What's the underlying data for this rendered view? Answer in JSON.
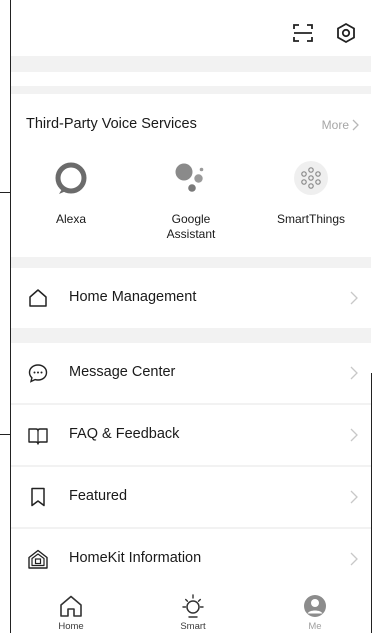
{
  "voice_services": {
    "title": "Third-Party Voice Services",
    "more_label": "More",
    "items": [
      {
        "name": "Alexa",
        "icon": "alexa-ring-icon"
      },
      {
        "name": "Google\nAssistant",
        "icon": "google-assistant-dots-icon"
      },
      {
        "name": "SmartThings",
        "icon": "smartthings-icon"
      }
    ]
  },
  "menu": [
    {
      "label": "Home Management",
      "icon": "house-outline-icon"
    },
    {
      "label": "Message Center",
      "icon": "chat-bubble-icon"
    },
    {
      "label": "FAQ & Feedback",
      "icon": "open-book-icon"
    },
    {
      "label": "Featured",
      "icon": "bookmark-icon"
    },
    {
      "label": "HomeKit Information",
      "icon": "homekit-house-icon"
    }
  ],
  "tabs": [
    {
      "label": "Home",
      "icon": "home-tab-icon"
    },
    {
      "label": "Smart",
      "icon": "sun-tab-icon"
    },
    {
      "label": "Me",
      "icon": "profile-tab-icon"
    }
  ],
  "colors": {
    "background": "#f2f2f2",
    "alexa_ring": "#6b6b6b",
    "muted_text": "#a6a6a6",
    "chevron": "#c8c8c8"
  }
}
